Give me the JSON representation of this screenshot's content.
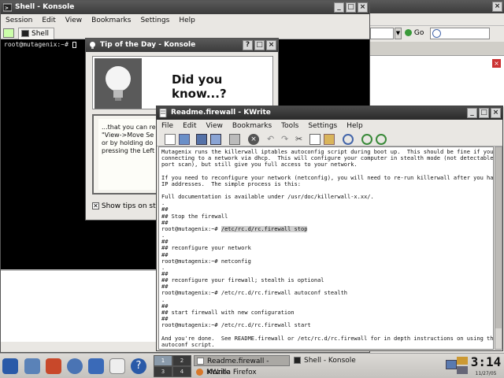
{
  "konsole": {
    "title": "Shell - Konsole",
    "menu": [
      "Session",
      "Edit",
      "View",
      "Bookmarks",
      "Settings",
      "Help"
    ],
    "tab_label": "Shell",
    "prompt": "root@mutagenix:~# "
  },
  "firefox": {
    "go_label": "Go"
  },
  "tip": {
    "title": "Tip of the Day - Konsole",
    "heading": "Did you know...?",
    "body": "...that you can re\n\"View->Move Se\nor by holding do\npressing the Left",
    "checkbox_label": "Show tips on start"
  },
  "kwrite": {
    "title": "Readme.firewall - KWrite",
    "menu": [
      "File",
      "Edit",
      "View",
      "Bookmarks",
      "Tools",
      "Settings",
      "Help"
    ],
    "lines": [
      "Mutagenix runs the killerwall iptables autoconfig script during boot up.  This should be fine if you are",
      "connecting to a network via dhcp.  This will configure your computer in stealth mode (not detectable during a",
      "port scan), but still give you full access to your network.",
      "",
      "If you need to reconfigure your network (netconfig), you will need to re-run killerwall after you have changed",
      "IP addresses.  The simple process is this:",
      "",
      "Full documentation is available under /usr/doc/killerwall-x.xx/.",
      ".",
      "##",
      "## Stop the firewall",
      "##",
      "root@mutagenix:~# /etc/rc.d/rc.firewall stop",
      ".",
      "##",
      "## reconfigure your network",
      "##",
      "root@mutagenix:~# netconfig",
      ".",
      "##",
      "## reconfigure your firewall; stealth is optional",
      "##",
      "root@mutagenix:~# /etc/rc.d/rc.firewall autoconf stealth",
      ".",
      "##",
      "## start firewall with new configuration",
      "##",
      "root@mutagenix:~# /etc/rc.d/rc.firewall start",
      "",
      "And you're done.  See README.firewall or /etc/rc.d/rc.firewall for in depth instructions on using the killerwall",
      "autoconf script."
    ]
  },
  "taskbar": {
    "desktops": [
      "1",
      "2",
      "3",
      "4"
    ],
    "tasks": [
      "Readme.firewall - KWrite",
      "Shell - Konsole",
      "Mozilla Firefox"
    ],
    "clock_time": "3:14",
    "clock_date": "11/27/05"
  }
}
